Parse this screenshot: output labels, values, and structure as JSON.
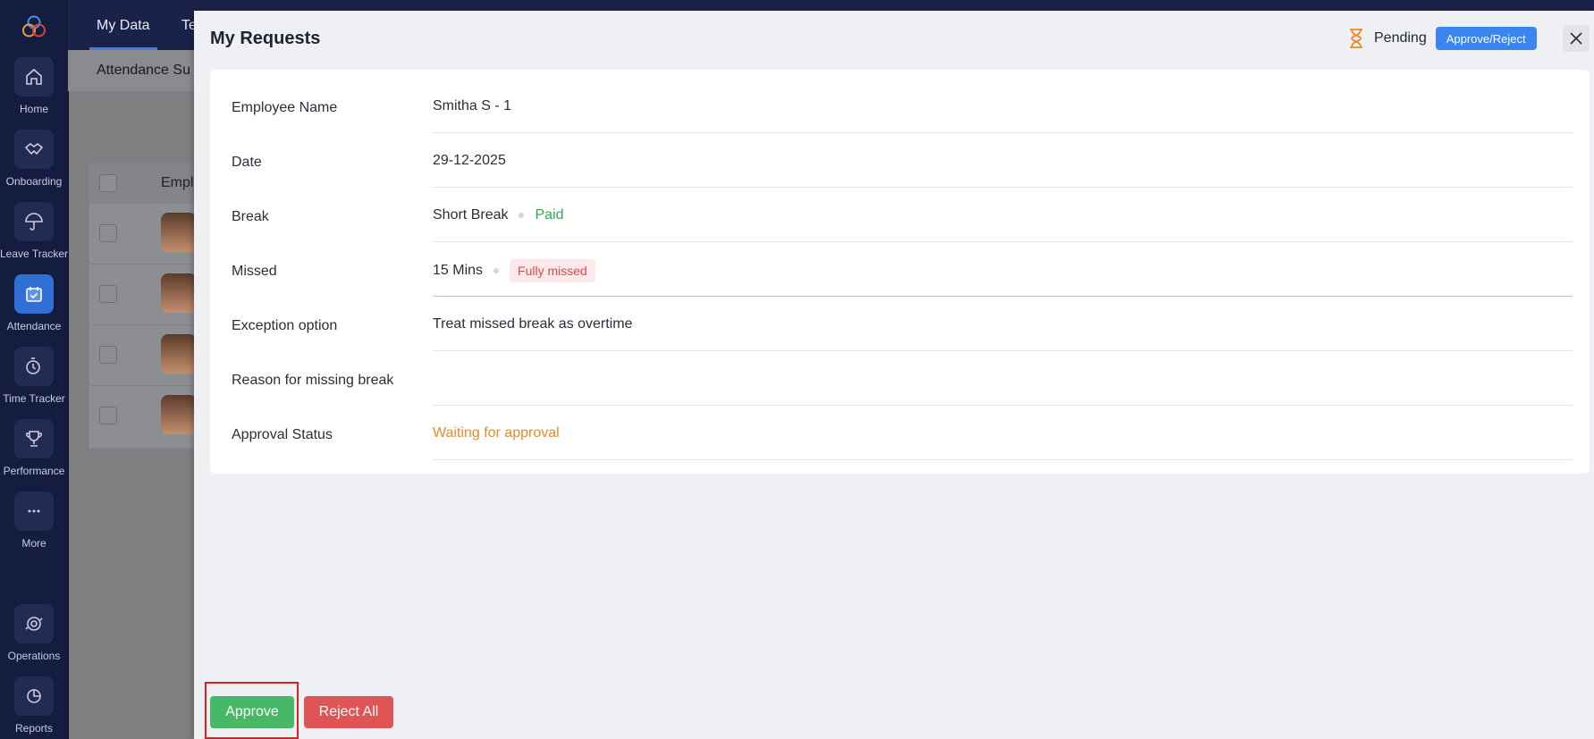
{
  "nav": {
    "items": [
      {
        "label": "Home",
        "icon": "home-icon"
      },
      {
        "label": "Onboarding",
        "icon": "handshake-icon"
      },
      {
        "label": "Leave Tracker",
        "icon": "umbrella-icon"
      },
      {
        "label": "Attendance",
        "icon": "calendar-check-icon"
      },
      {
        "label": "Time Tracker",
        "icon": "stopwatch-icon"
      },
      {
        "label": "Performance",
        "icon": "trophy-icon"
      },
      {
        "label": "More",
        "icon": "more-icon"
      },
      {
        "label": "Operations",
        "icon": "operations-icon"
      },
      {
        "label": "Reports",
        "icon": "pie-chart-icon"
      }
    ],
    "active": "Attendance"
  },
  "background": {
    "tabs": [
      "My Data",
      "Te"
    ],
    "subtitle": "Attendance Su",
    "table_header": "Empl"
  },
  "drawer": {
    "title": "My Requests",
    "status": "Pending",
    "approve_reject_label": "Approve/Reject",
    "fields": {
      "employee_name": {
        "label": "Employee Name",
        "value": "Smitha S - 1"
      },
      "date": {
        "label": "Date",
        "value": "29-12-2025"
      },
      "break": {
        "label": "Break",
        "value": "Short Break",
        "tag": "Paid"
      },
      "missed": {
        "label": "Missed",
        "value": "15 Mins",
        "tag": "Fully missed"
      },
      "exception": {
        "label": "Exception option",
        "value": "Treat missed break as overtime"
      },
      "reason": {
        "label": "Reason for missing break",
        "value": ""
      },
      "approval": {
        "label": "Approval Status",
        "value": "Waiting for approval"
      }
    },
    "actions": {
      "approve": "Approve",
      "reject_all": "Reject All"
    }
  },
  "colors": {
    "rail": "#141c40",
    "accent_blue": "#3a85f0",
    "approve_green": "#47b866",
    "reject_red": "#df5454",
    "paid_green": "#34a853",
    "waiting_orange": "#e6892b"
  }
}
